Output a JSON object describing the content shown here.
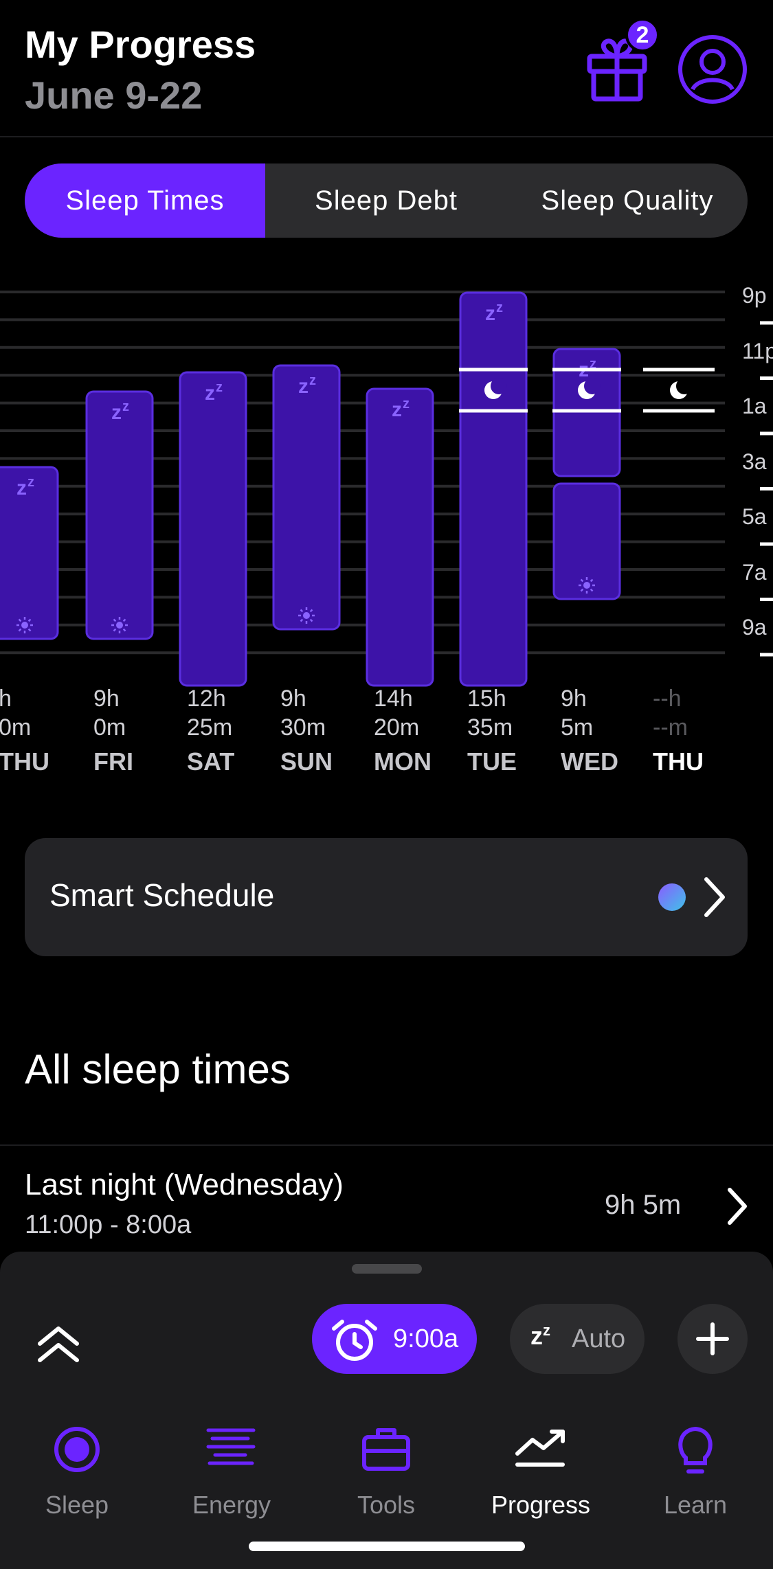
{
  "header": {
    "title": "My Progress",
    "subtitle": "June 9-22",
    "badge_count": "2"
  },
  "tabs": [
    "Sleep Times",
    "Sleep Debt",
    "Sleep Quality"
  ],
  "chart_data": {
    "type": "bar",
    "y_ticks": [
      "9p",
      "11p",
      "1a",
      "3a",
      "5a",
      "7a",
      "9a"
    ],
    "columns": [
      {
        "day": "THU",
        "hours": "h",
        "minutes": "0m",
        "start": 5.0,
        "end": 10.0,
        "wake_icon": true
      },
      {
        "day": "FRI",
        "hours": "9h",
        "minutes": "0m",
        "start": 0.5,
        "end": 10.0,
        "wake_icon": true
      },
      {
        "day": "SAT",
        "hours": "12h",
        "minutes": "25m",
        "start": -0.2,
        "end": 12.4
      },
      {
        "day": "SUN",
        "hours": "9h",
        "minutes": "30m",
        "start": -0.5,
        "end": 9.0,
        "wake_icon": true
      },
      {
        "day": "MON",
        "hours": "14h",
        "minutes": "20m",
        "start": 0.5,
        "end": 12.4
      },
      {
        "day": "TUE",
        "hours": "15h",
        "minutes": "35m",
        "start": -3.0,
        "end": 12.4,
        "moon": true
      },
      {
        "day": "WED",
        "hours": "9h",
        "minutes": "5m",
        "start": -1.0,
        "end": 3.5,
        "second_start": 3.8,
        "second_end": 8.0,
        "moon": true,
        "wake_icon": true
      },
      {
        "day": "THU",
        "hours": "--h",
        "minutes": "--m",
        "moon": true,
        "today": true
      }
    ]
  },
  "smart_schedule": {
    "label": "Smart Schedule"
  },
  "section": {
    "title": "All sleep times"
  },
  "last_night": {
    "title": "Last night (Wednesday)",
    "range": "11:00p - 8:00a",
    "duration": "9h 5m"
  },
  "sheet": {
    "alarm_time": "9:00a",
    "auto_label": "Auto"
  },
  "tabbar": [
    {
      "label": "Sleep",
      "icon": "sleep-icon"
    },
    {
      "label": "Energy",
      "icon": "energy-icon"
    },
    {
      "label": "Tools",
      "icon": "toolbox-icon"
    },
    {
      "label": "Progress",
      "icon": "progress-icon",
      "active": true
    },
    {
      "label": "Learn",
      "icon": "lightbulb-icon"
    }
  ],
  "colors": {
    "accent": "#6b24ff",
    "bar": "#3d13a8",
    "bar_border": "#5a2ee0"
  }
}
